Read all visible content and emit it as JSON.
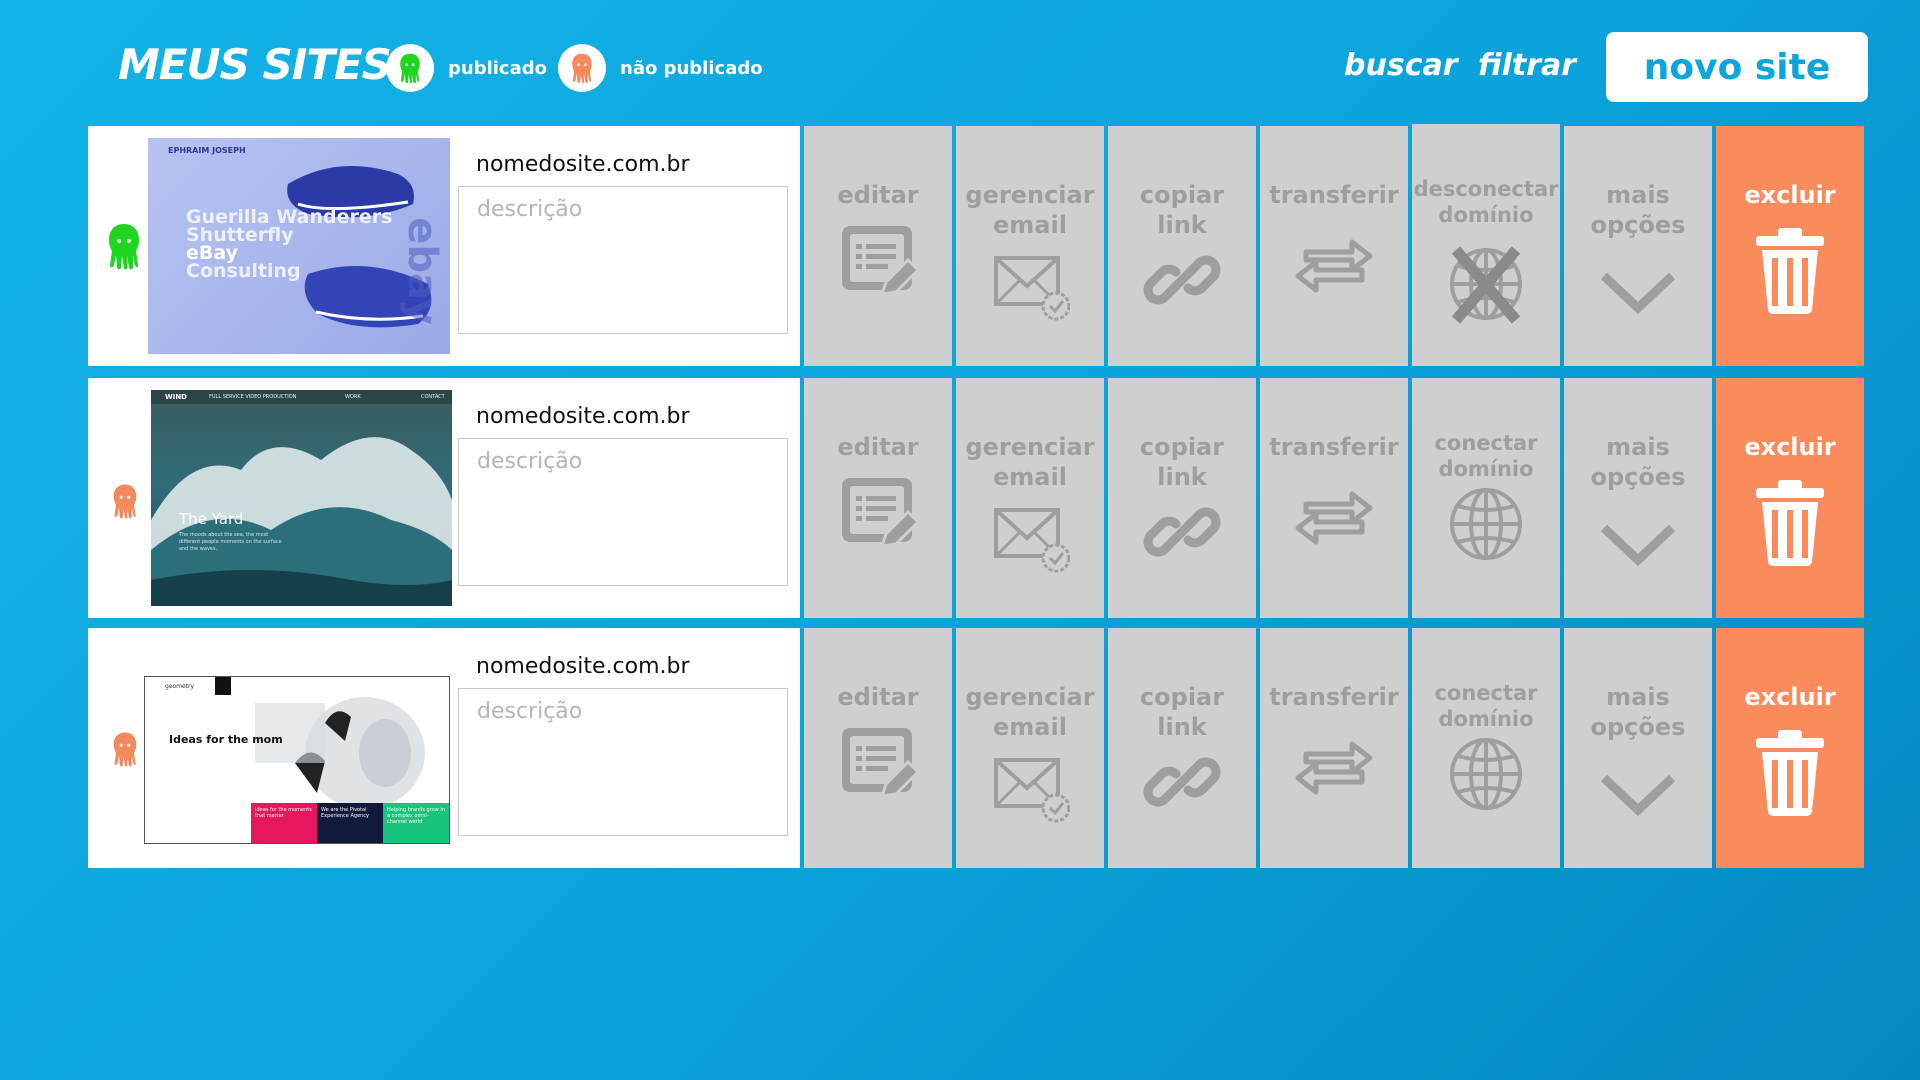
{
  "header": {
    "title": "MEUS SITES",
    "legend_published": "publicado",
    "legend_unpublished": "não publicado",
    "search_label": "buscar",
    "filter_label": "filtrar",
    "new_site_label": "novo site"
  },
  "colors": {
    "published": "#1fd51f",
    "unpublished": "#f48a5c",
    "delete": "#f98b5c",
    "action_bg": "#cfcfcf",
    "action_fg": "#9e9e9e"
  },
  "sites": [
    {
      "domain": "nomedosite.com.br",
      "description_placeholder": "descrição",
      "status": "publicado",
      "thumb": {
        "t1": "EPHRAIM JOSEPH",
        "t2": "Guerilla Wanderers",
        "t3": "Shutterfly",
        "t4": "eBay",
        "t5": "Consulting",
        "t6": "ebay"
      },
      "actions": {
        "edit": "editar",
        "email1": "gerenciar",
        "email2": "email",
        "copy1": "copiar",
        "copy2": "link",
        "transfer": "transferir",
        "domain1": "desconectar",
        "domain2": "domínio",
        "more1": "mais",
        "more2": "opções",
        "delete": "excluir"
      }
    },
    {
      "domain": "nomedosite.com.br",
      "description_placeholder": "descrição",
      "status": "não publicado",
      "thumb": {
        "t1": "WIND",
        "t2": "FULL SERVICE VIDEO PRODUCTION",
        "t3": "WORK",
        "t4": "CONTACT",
        "t5": "The Yard",
        "t6": "The moods about the sea, the most different people moments on the surface and the waves."
      },
      "actions": {
        "edit": "editar",
        "email1": "gerenciar",
        "email2": "email",
        "copy1": "copiar",
        "copy2": "link",
        "transfer": "transferir",
        "domain1": "conectar",
        "domain2": "domínio",
        "more1": "mais",
        "more2": "opções",
        "delete": "excluir"
      }
    },
    {
      "domain": "nomedosite.com.br",
      "description_placeholder": "descrição",
      "status": "não publicado",
      "thumb": {
        "t1": "geometry",
        "t2": "Ideas for the mom",
        "t3": "Ideas for the moments that matter",
        "t4": "We are the Pivotal Experience Agency",
        "t5": "Helping brands grow in a complex omni-channel world"
      },
      "actions": {
        "edit": "editar",
        "email1": "gerenciar",
        "email2": "email",
        "copy1": "copiar",
        "copy2": "link",
        "transfer": "transferir",
        "domain1": "conectar",
        "domain2": "domínio",
        "more1": "mais",
        "more2": "opções",
        "delete": "excluir"
      }
    }
  ]
}
